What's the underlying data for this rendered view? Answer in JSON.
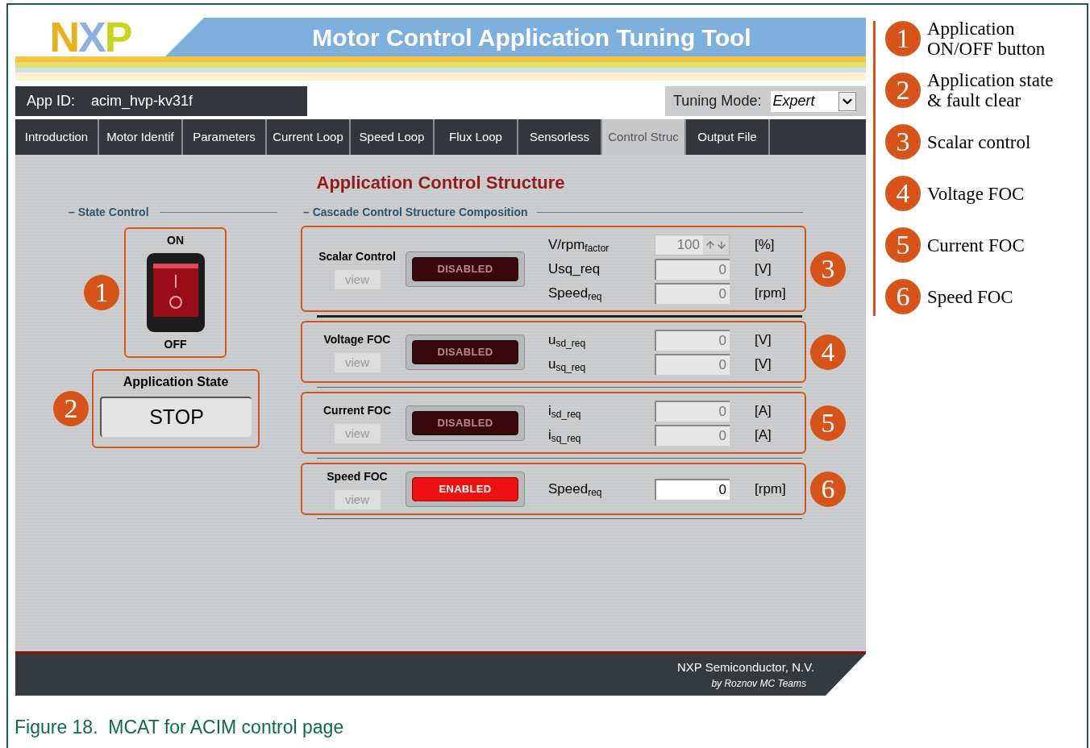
{
  "header": {
    "logo": "NXP",
    "title": "Motor Control Application Tuning Tool"
  },
  "app_id": {
    "label": "App ID:",
    "value": "acim_hvp-kv31f"
  },
  "tuning_mode": {
    "label": "Tuning Mode:",
    "value": "Expert"
  },
  "tabs": [
    {
      "label": "Introduction",
      "selected": false
    },
    {
      "label": "Motor Identif",
      "selected": false
    },
    {
      "label": "Parameters",
      "selected": false
    },
    {
      "label": "Current Loop",
      "selected": false
    },
    {
      "label": "Speed Loop",
      "selected": false
    },
    {
      "label": "Flux Loop",
      "selected": false
    },
    {
      "label": "Sensorless",
      "selected": false
    },
    {
      "label": "Control Struc",
      "selected": true
    },
    {
      "label": "Output File",
      "selected": false
    }
  ],
  "page_title": "Application Control Structure",
  "state_control": {
    "title": "– State Control",
    "switch": {
      "on_label": "ON",
      "off_label": "OFF",
      "on": false,
      "callout": "1"
    },
    "state": {
      "title": "Application State",
      "value": "STOP",
      "callout": "2"
    }
  },
  "cascade": {
    "title": "– Cascade Control Structure Composition",
    "blocks": [
      {
        "name": "Scalar Control",
        "view": "view",
        "status": "DISABLED",
        "enabled": false,
        "callout": "3",
        "params": [
          {
            "kind": "spinner",
            "label": "V/rpm$_{factor}$",
            "value": "100",
            "unit": "[%]",
            "editable": false
          },
          {
            "kind": "field",
            "label": "Usq_req",
            "value": "0",
            "unit": "[V]",
            "editable": false
          },
          {
            "kind": "field",
            "label": "Speed$_{req}$",
            "value": "0",
            "unit": "[rpm]",
            "editable": false
          }
        ]
      },
      {
        "name": "Voltage FOC",
        "view": "view",
        "status": "DISABLED",
        "enabled": false,
        "callout": "4",
        "params": [
          {
            "kind": "field",
            "label": "u$_{sd_req}$",
            "value": "0",
            "unit": "[V]",
            "editable": false
          },
          {
            "kind": "field",
            "label": "u$_{sq_req}$",
            "value": "0",
            "unit": "[V]",
            "editable": false
          }
        ]
      },
      {
        "name": "Current FOC",
        "view": "view",
        "status": "DISABLED",
        "enabled": false,
        "callout": "5",
        "params": [
          {
            "kind": "field",
            "label": "i$_{sd_req}$",
            "value": "0",
            "unit": "[A]",
            "editable": false
          },
          {
            "kind": "field",
            "label": "i$_{sq_req}$",
            "value": "0",
            "unit": "[A]",
            "editable": false
          }
        ]
      },
      {
        "name": "Speed FOC",
        "view": "view",
        "status": "ENABLED",
        "enabled": true,
        "callout": "6",
        "params": [
          {
            "kind": "field",
            "label": "Speed$_{req}$",
            "value": "0",
            "unit": "[rpm]",
            "editable": true
          }
        ]
      }
    ]
  },
  "footer": {
    "company": "NXP Semiconductor, N.V.",
    "credit": "by Roznov MC Teams"
  },
  "legend": [
    {
      "number": "1",
      "text": "Application ON/OFF button"
    },
    {
      "number": "2",
      "text": "Application state & fault clear"
    },
    {
      "number": "3",
      "text": "Scalar control"
    },
    {
      "number": "4",
      "text": "Voltage FOC"
    },
    {
      "number": "5",
      "text": "Current FOC"
    },
    {
      "number": "6",
      "text": "Speed FOC"
    }
  ],
  "caption": "Figure 18.  MCAT for ACIM control page"
}
